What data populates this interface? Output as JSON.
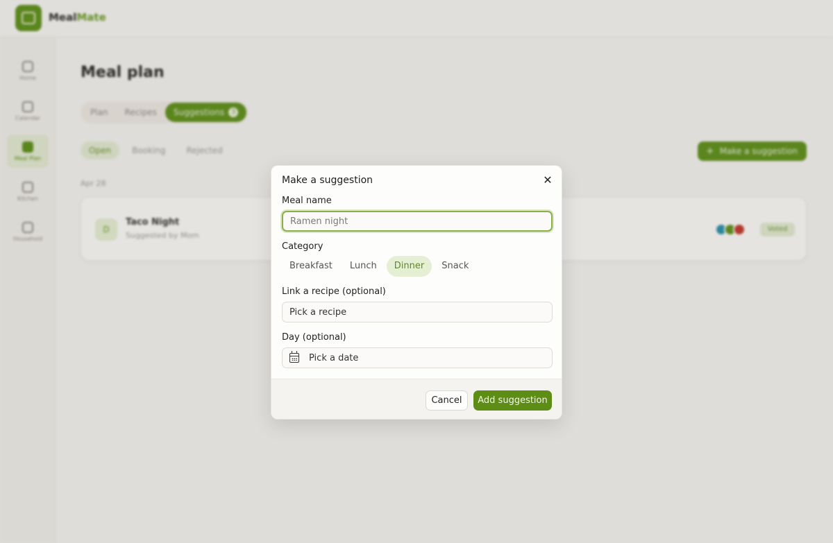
{
  "app": {
    "brand_part1": "Meal",
    "brand_part2": "Mate"
  },
  "sidebar": {
    "items": [
      {
        "label": "Home"
      },
      {
        "label": "Calendar"
      },
      {
        "label": "Meal Plan"
      },
      {
        "label": "Kitchen"
      },
      {
        "label": "Household"
      }
    ]
  },
  "main": {
    "title": "Meal plan",
    "tabs": [
      {
        "label": "Plan"
      },
      {
        "label": "Recipes"
      },
      {
        "label": "Suggestions",
        "badge": "3"
      }
    ],
    "filters": [
      {
        "label": "Open"
      },
      {
        "label": "Booking"
      },
      {
        "label": "Rejected"
      }
    ],
    "make_button": "Make a suggestion",
    "date_label": "Apr 28",
    "card": {
      "icon": "D",
      "title": "Taco Night",
      "subtitle": "Suggested by Mom",
      "status": "Voted"
    },
    "avatar_colors": [
      "#2a8fa8",
      "#5e8f1c",
      "#c0392b"
    ]
  },
  "modal": {
    "title": "Make a suggestion",
    "meal_name_label": "Meal name",
    "meal_name_placeholder": "Ramen night",
    "category_label": "Category",
    "categories": [
      "Breakfast",
      "Lunch",
      "Dinner",
      "Snack"
    ],
    "selected_category": "Dinner",
    "recipe_label": "Link a recipe (optional)",
    "recipe_placeholder": "Pick a recipe",
    "day_label": "Day (optional)",
    "day_placeholder": "Pick a date",
    "cancel_label": "Cancel",
    "submit_label": "Add suggestion",
    "close_icon": "close-icon",
    "calendar_icon": "calendar-icon"
  },
  "colors": {
    "accent": "#5e8d15",
    "accent_soft": "#e5efd3",
    "focus_ring": "#8ab04c"
  }
}
